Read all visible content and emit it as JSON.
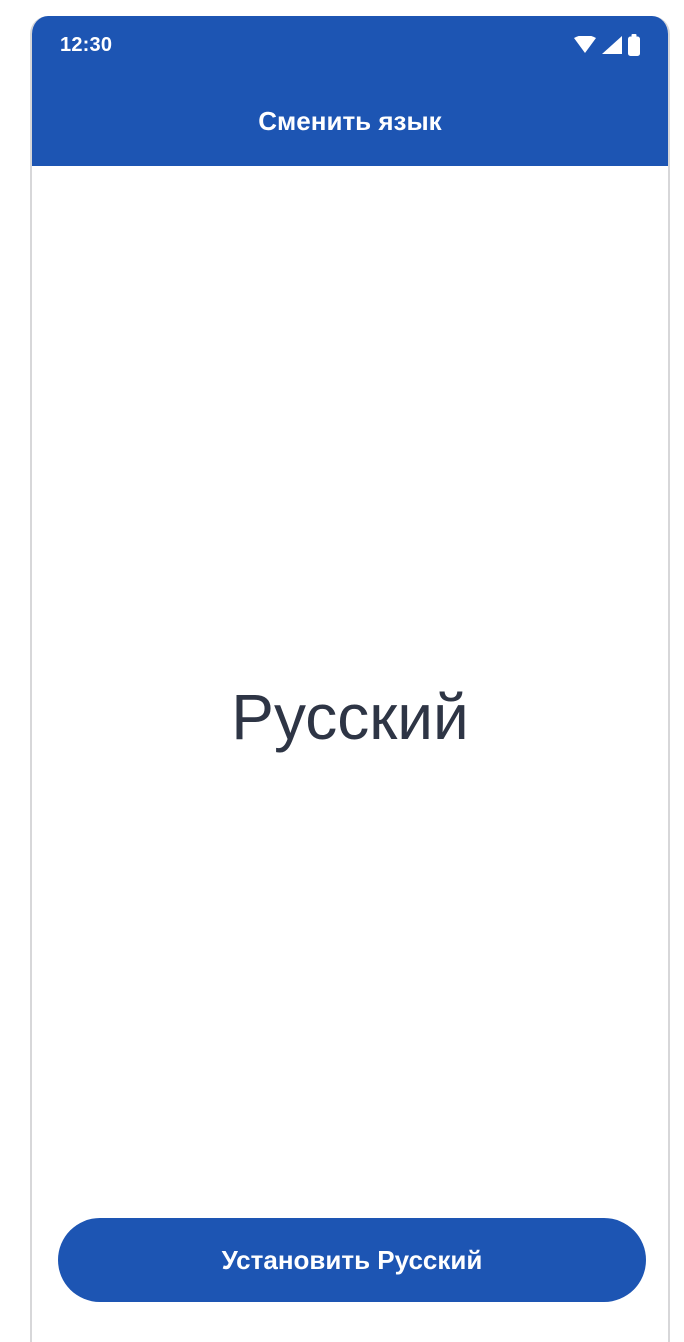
{
  "status_bar": {
    "time": "12:30",
    "icons": [
      "wifi-icon",
      "signal-icon",
      "battery-icon"
    ]
  },
  "header": {
    "title": "Сменить язык"
  },
  "main": {
    "language_name": "Русский"
  },
  "actions": {
    "set_language_label": "Установить Русский"
  },
  "colors": {
    "primary": "#1d55b3",
    "text_dark": "#2e3545",
    "background": "#ffffff"
  }
}
